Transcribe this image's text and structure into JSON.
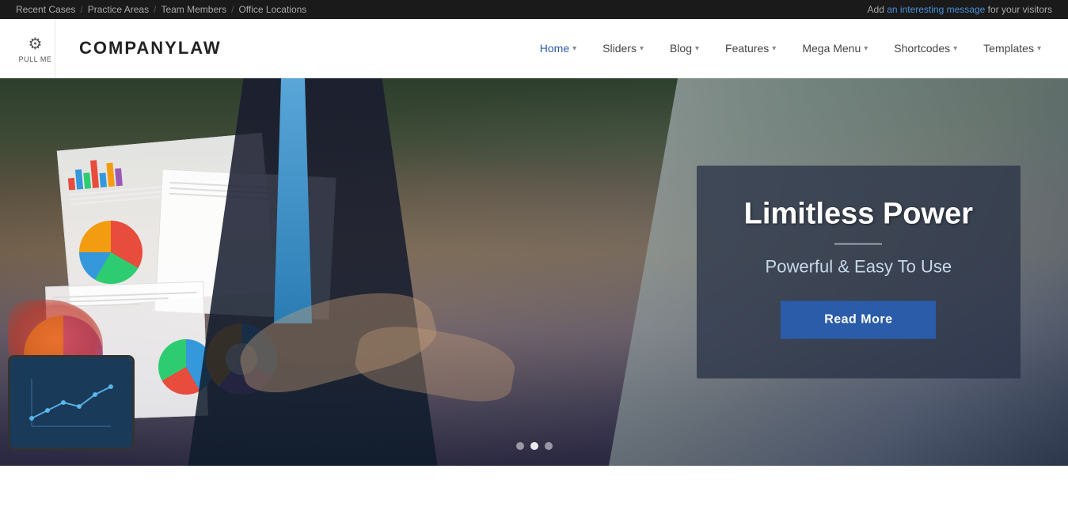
{
  "topbar": {
    "links": [
      {
        "label": "Recent Cases",
        "id": "recent-cases"
      },
      {
        "label": "Practice Areas",
        "id": "practice-areas"
      },
      {
        "label": "Team Members",
        "id": "team-members"
      },
      {
        "label": "Office Locations",
        "id": "office-locations"
      }
    ],
    "separator": "/",
    "right_text_prefix": "Add ",
    "right_text_link": "an interesting message",
    "right_text_suffix": " for your visitors"
  },
  "nav": {
    "pull_label": "PULL ME",
    "logo": "COMPANYLAW",
    "items": [
      {
        "label": "Home",
        "has_dropdown": true,
        "active": true
      },
      {
        "label": "Sliders",
        "has_dropdown": true,
        "active": false
      },
      {
        "label": "Blog",
        "has_dropdown": true,
        "active": false
      },
      {
        "label": "Features",
        "has_dropdown": true,
        "active": false
      },
      {
        "label": "Mega Menu",
        "has_dropdown": true,
        "active": false
      },
      {
        "label": "Shortcodes",
        "has_dropdown": true,
        "active": false
      },
      {
        "label": "Templates",
        "has_dropdown": true,
        "active": false
      }
    ]
  },
  "hero": {
    "title": "Limitless Power",
    "subtitle": "Powerful & Easy To Use",
    "cta_label": "Read More",
    "dots": [
      {
        "active": false
      },
      {
        "active": true
      },
      {
        "active": false
      }
    ]
  }
}
